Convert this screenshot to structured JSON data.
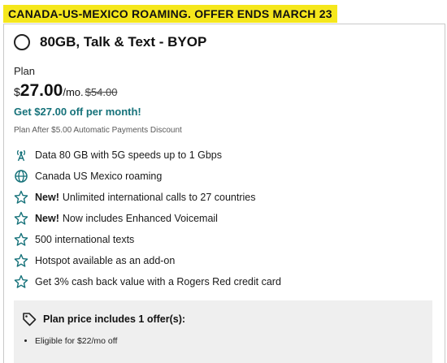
{
  "promo_banner": "CANADA-US-MEXICO ROAMING. OFFER ENDS MARCH 23",
  "plan": {
    "name": "80GB, Talk & Text - BYOP",
    "label": "Plan",
    "price_currency": "$",
    "price_amount": "27.00",
    "price_period": "/mo.",
    "price_original": "$54.00",
    "offer_line": "Get $27.00 off per month!",
    "discount_note": "Plan After $5.00 Automatic Payments Discount"
  },
  "features": [
    {
      "icon": "signal-tower-icon",
      "badge": "",
      "text": "Data 80 GB with 5G speeds up to 1 Gbps"
    },
    {
      "icon": "globe-icon",
      "badge": "",
      "text": "Canada US Mexico roaming"
    },
    {
      "icon": "star-icon",
      "badge": "New!",
      "text": "Unlimited international calls to 27 countries"
    },
    {
      "icon": "star-icon",
      "badge": "New!",
      "text": "Now includes Enhanced Voicemail"
    },
    {
      "icon": "star-icon",
      "badge": "",
      "text": "500 international texts"
    },
    {
      "icon": "star-icon",
      "badge": "",
      "text": "Hotspot available as an add-on"
    },
    {
      "icon": "star-icon",
      "badge": "",
      "text": "Get 3% cash back value with a Rogers Red credit card"
    }
  ],
  "offer_box": {
    "icon": "tag-icon",
    "title": "Plan price includes 1 offer(s):",
    "items": [
      "Eligible for $22/mo off"
    ]
  },
  "colors": {
    "banner": "#f5e71c",
    "accent_teal": "#16727a",
    "offer_box_bg": "#efefef"
  }
}
